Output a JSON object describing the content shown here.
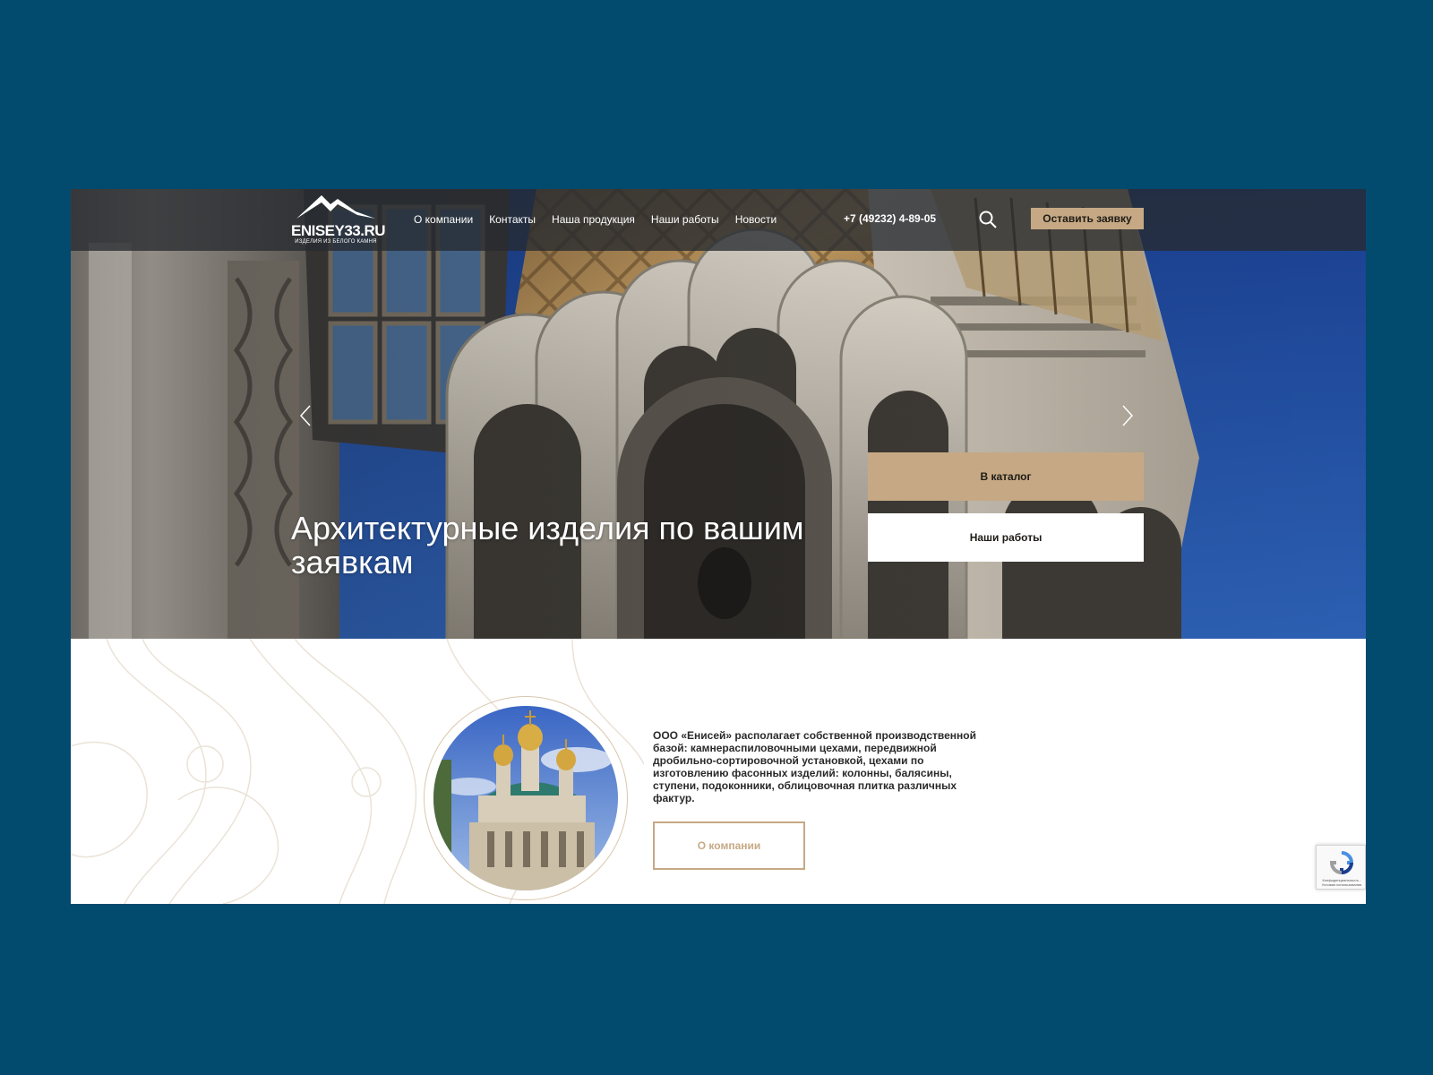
{
  "header": {
    "logo_text": "ENISEY33.RU",
    "logo_subtitle": "ИЗДЕЛИЯ ИЗ БЕЛОГО КАМНЯ",
    "nav": [
      "О компании",
      "Контакты",
      "Наша продукция",
      "Наши работы",
      "Новости"
    ],
    "phone": "+7 (49232) 4-89-05",
    "cta_label": "Оставить заявку"
  },
  "hero": {
    "title": "Архитектурные изделия по вашим заявкам",
    "catalog_button": "В каталог",
    "works_button": "Наши работы"
  },
  "about": {
    "text": "ООО «Енисей» располагает собственной производственной базой: камнераспиловочными цехами, передвижной дробильно-сортировочной установкой, цехами по изготовлению фасонных изделий: колонны, балясины, ступени, подоконники, облицовочная плитка различных фактур.",
    "button": "О компании"
  },
  "recaptcha": {
    "text": "Конфиденциальность - Условия использования"
  },
  "colors": {
    "background": "#034a6f",
    "accent_gold": "#c6a984",
    "header_overlay": "#262a30"
  },
  "icons": [
    "logo-mountain-icon",
    "search-icon",
    "arrow-left-icon",
    "arrow-right-icon",
    "recaptcha-icon"
  ]
}
